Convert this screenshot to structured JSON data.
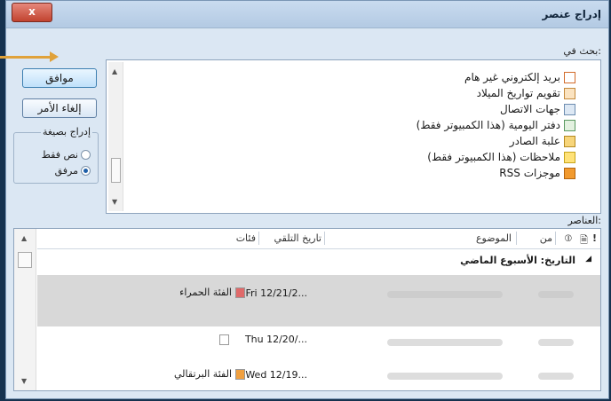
{
  "window": {
    "title": "إدراج عنصر",
    "close_label": "x"
  },
  "look_in_label": "بحث في:",
  "folders": [
    {
      "label": "بريد إلكتروني غير هام",
      "icon": "junk-mail-icon"
    },
    {
      "label": "تقويم تواريخ الميلاد",
      "icon": "calendar-icon"
    },
    {
      "label": "جهات الاتصال",
      "icon": "contacts-icon"
    },
    {
      "label": "دفتر اليومية (هذا الكمبيوتر فقط)",
      "icon": "journal-icon"
    },
    {
      "label": "علبة الصادر",
      "icon": "outbox-icon"
    },
    {
      "label": "ملاحظات (هذا الكمبيوتر فقط)",
      "icon": "notes-icon"
    },
    {
      "label": "موجزات RSS",
      "icon": "rss-icon"
    }
  ],
  "buttons": {
    "ok": "موافق",
    "cancel": "إلغاء الأمر"
  },
  "insert_as": {
    "title": "إدراج بصيغة",
    "options": [
      {
        "label": "نص فقط",
        "checked": false
      },
      {
        "label": "مرفق",
        "checked": true
      }
    ]
  },
  "items_label": "العناصر:",
  "columns": {
    "importance": "!",
    "from": "من",
    "subject": "الموضوع",
    "received": "تاريخ التلقي",
    "categories": "فئات"
  },
  "group_header": "التاريخ: الأسبوع الماضي",
  "rows": [
    {
      "date": "Fri 12/21/2...",
      "category": "الفئة الحمراء",
      "category_color": "#e06a6a",
      "selected": true
    },
    {
      "date": "Thu 12/20/...",
      "category": "",
      "category_color": "#ffffff",
      "selected": false
    },
    {
      "date": "Wed 12/19...",
      "category": "الفئة البرتقالي",
      "category_color": "#f0a040",
      "selected": false
    }
  ],
  "accent_color": "#3d86c8"
}
